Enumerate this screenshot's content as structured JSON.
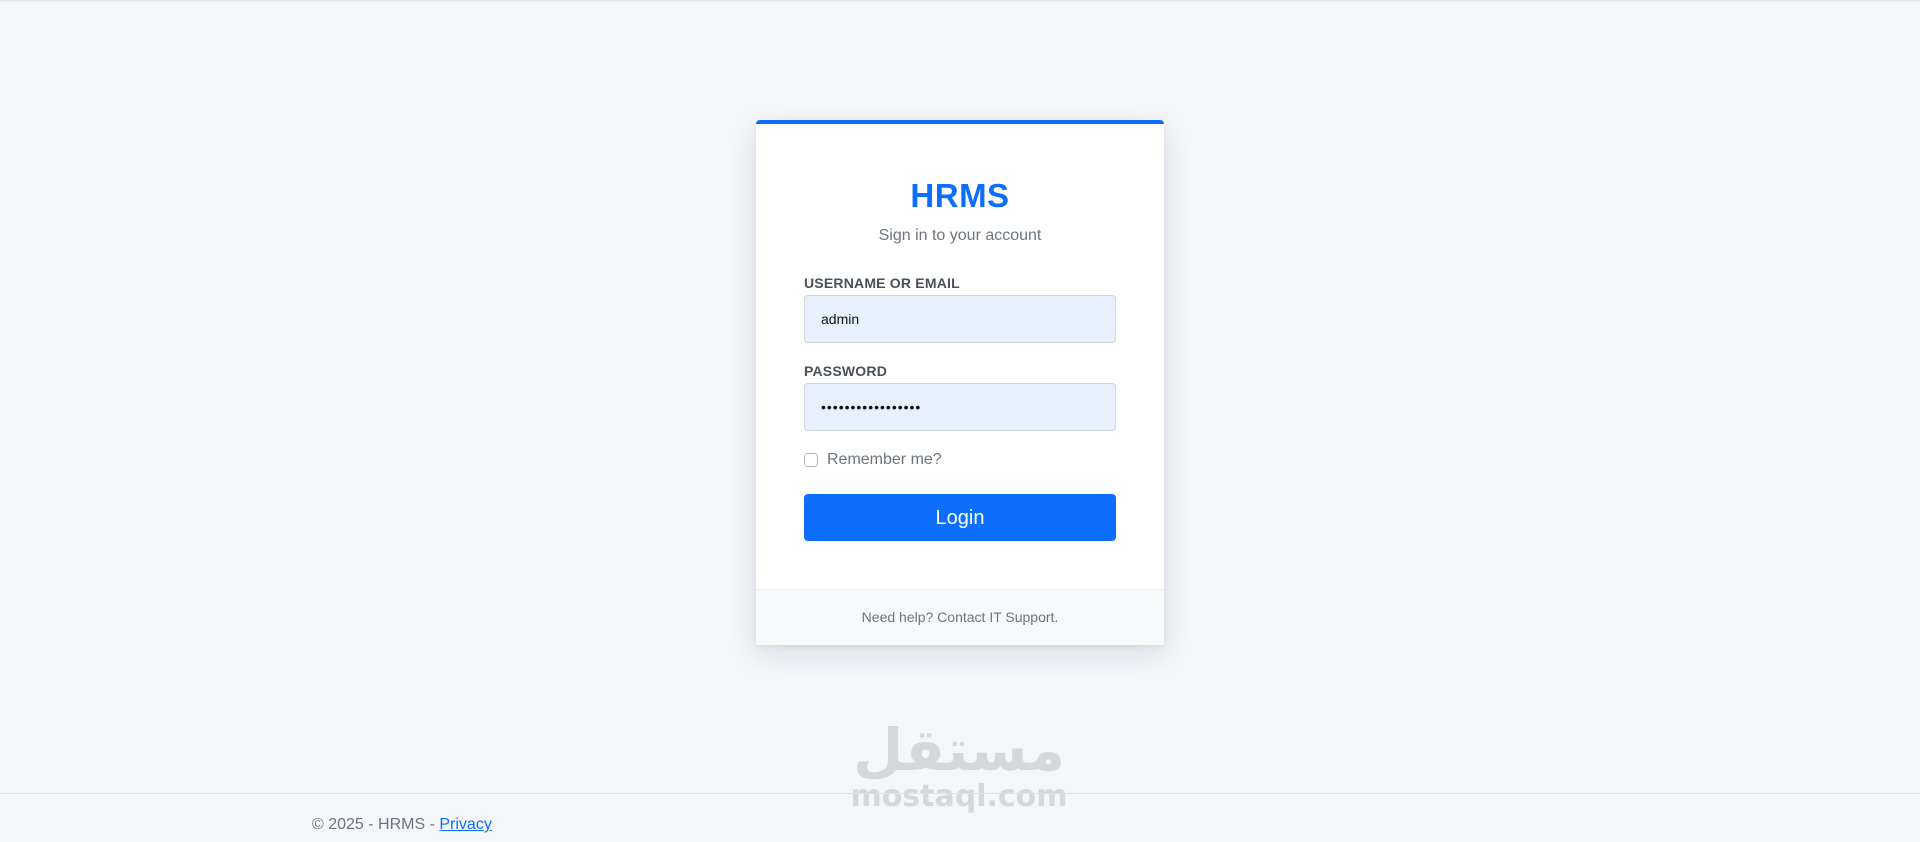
{
  "brand": {
    "title": "HRMS",
    "subtitle": "Sign in to your account"
  },
  "form": {
    "username_label": "USERNAME OR EMAIL",
    "username_value": "admin",
    "password_label": "PASSWORD",
    "password_value": "•••••••••••••••••",
    "remember_label": "Remember me?",
    "remember_checked": false,
    "login_label": "Login"
  },
  "card_footer": {
    "help_text": "Need help? Contact IT Support."
  },
  "page_footer": {
    "copyright": "© 2025 - HRMS - ",
    "privacy_label": "Privacy"
  },
  "watermark": {
    "arabic": "مستقل",
    "latin": "mostaql.com"
  },
  "colors": {
    "accent": "#0d6efd",
    "background": "#f4f6fa",
    "input_fill": "#e8f0fe"
  }
}
